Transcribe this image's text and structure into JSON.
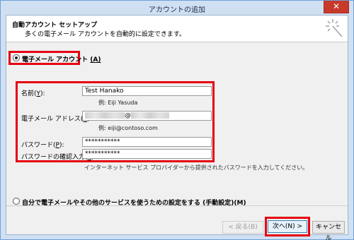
{
  "window": {
    "title": "アカウントの追加",
    "close_glyph": "✕"
  },
  "header": {
    "title": "自動アカウント セットアップ",
    "subtitle": "多くの電子メール アカウントを自動的に設定できます。",
    "icon": "setup-wand-icon"
  },
  "email_account_option": {
    "label": "電子メール アカウント",
    "accel": "(A)",
    "selected": true
  },
  "form": {
    "name_label": "名前(",
    "name_key": "Y",
    "name_label_end": "):",
    "name_value": "Test Hanako",
    "name_example": "例: Eiji Yasuda",
    "email_label": "電子メール アドレス(",
    "email_key": "E",
    "email_label_end": "):",
    "email_at": "@",
    "email_example": "例: eiji@contoso.com",
    "password_label": "パスワード(",
    "password_key": "P",
    "password_label_end": "):",
    "password_value": "***********",
    "confirm_label": "パスワードの確認入力(",
    "confirm_key": "T",
    "confirm_label_end": "):",
    "confirm_value": "***********",
    "hint": "インターネット サービス プロバイダーから提供されたパスワードを入力してください。"
  },
  "manual_option": {
    "label": "自分で電子メールやその他のサービスを使うための設定をする (手動設定)",
    "accel": "(M)",
    "selected": false
  },
  "buttons": {
    "back": "< 戻る(B)",
    "next": "次へ(N) >",
    "cancel": "キャンセル"
  },
  "colors": {
    "highlight": "#e60012",
    "window_border": "#6f9fd6",
    "close_button": "#c7392b"
  }
}
